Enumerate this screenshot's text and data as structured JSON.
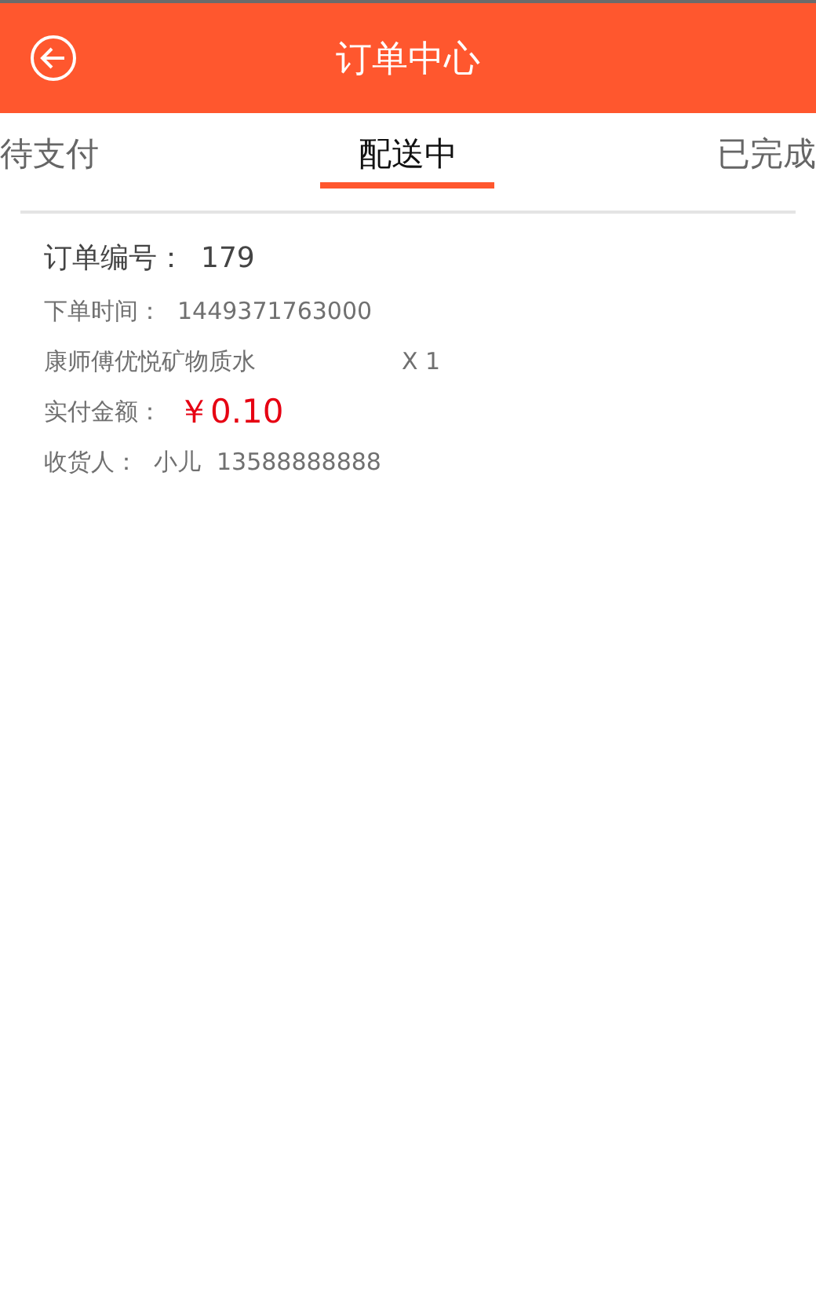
{
  "header": {
    "title": "订单中心"
  },
  "tabs": [
    {
      "label": "待支付",
      "selected": false
    },
    {
      "label": "配送中",
      "selected": true
    },
    {
      "label": "已完成",
      "selected": false
    }
  ],
  "orders": [
    {
      "number_label": "订单编号：",
      "number": "179",
      "time_label": "下单时间：",
      "time": "1449371763000",
      "product": "康师傅优悦矿物质水",
      "quantity": "X 1",
      "amount_label": "实付金额：",
      "amount": "￥0.10",
      "receiver_label": "收货人：",
      "receiver_name": "小儿",
      "receiver_phone": "13588888888"
    }
  ]
}
